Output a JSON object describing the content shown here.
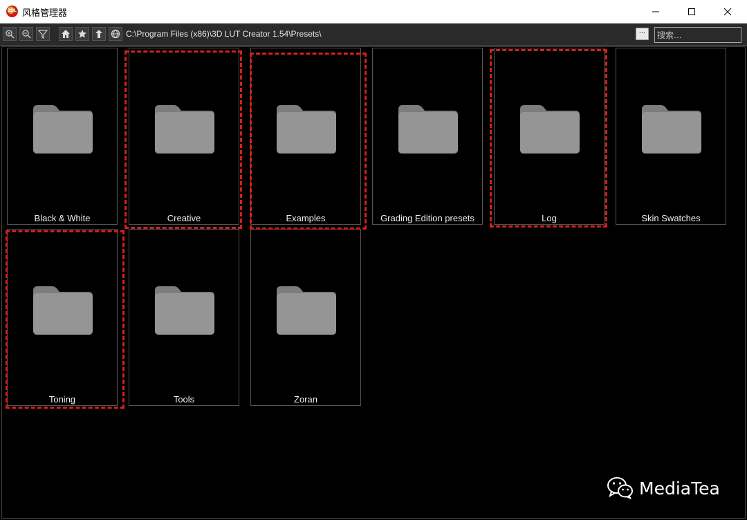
{
  "window": {
    "title": "风格管理器",
    "app_icon_text": "3DL"
  },
  "toolbar": {
    "path": "C:\\Program Files (x86)\\3D LUT Creator 1.54\\Presets\\",
    "more_label": "...",
    "search_placeholder": "搜索...",
    "buttons": [
      "zoom-in-icon",
      "zoom-out-icon",
      "filter-icon",
      "home-icon",
      "star-icon",
      "up-arrow-icon",
      "globe-icon"
    ]
  },
  "folders": [
    {
      "label": "Black & White",
      "highlighted": false
    },
    {
      "label": "Creative",
      "highlighted": true
    },
    {
      "label": "Examples",
      "highlighted": true
    },
    {
      "label": "Grading Edition presets",
      "highlighted": false
    },
    {
      "label": "Log",
      "highlighted": true
    },
    {
      "label": "Skin Swatches",
      "highlighted": false
    },
    {
      "label": "Toning",
      "highlighted": true
    },
    {
      "label": "Tools",
      "highlighted": false
    },
    {
      "label": "Zoran",
      "highlighted": false
    }
  ],
  "watermark": {
    "text": "MediaTea"
  },
  "colors": {
    "highlight": "#d42020",
    "folder": "#909090",
    "background": "#000000"
  }
}
